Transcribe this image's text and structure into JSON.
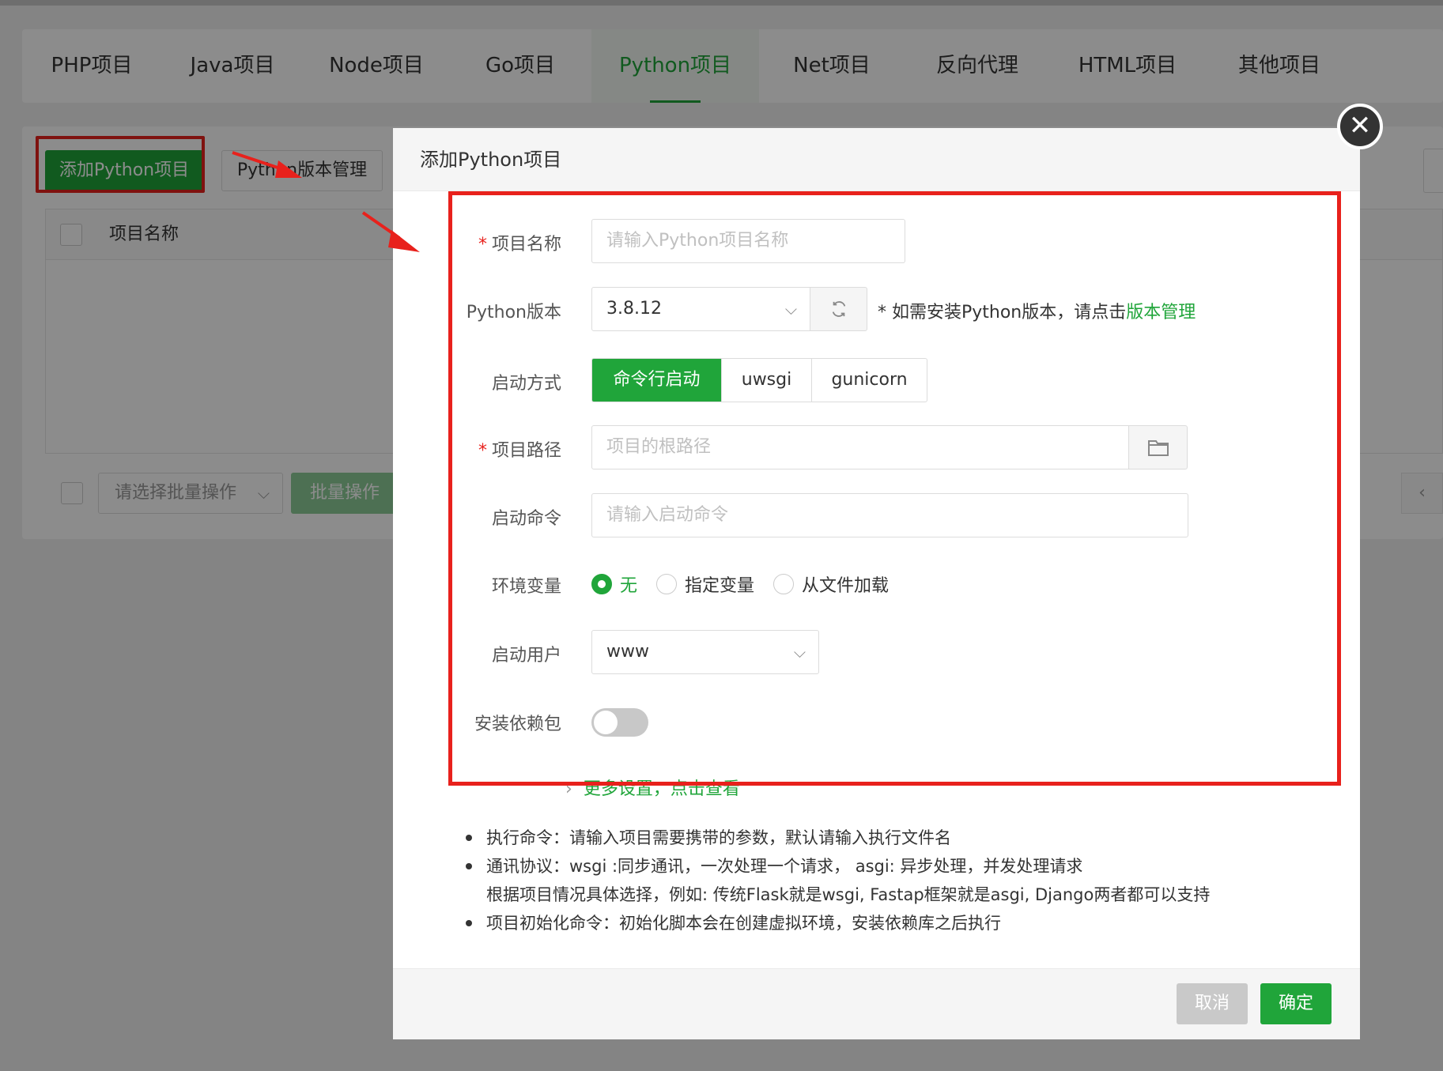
{
  "tabs": [
    "PHP项目",
    "Java项目",
    "Node项目",
    "Go项目",
    "Python项目",
    "Net项目",
    "反向代理",
    "HTML项目",
    "其他项目"
  ],
  "active_tab": "Python项目",
  "toolbar": {
    "add_label": "添加Python项目",
    "version_label": "Python版本管理"
  },
  "table": {
    "col_name": "项目名称"
  },
  "batch": {
    "select_placeholder": "请选择批量操作",
    "button_label": "批量操作"
  },
  "dialog": {
    "title": "添加Python项目",
    "name": {
      "label": "项目名称",
      "placeholder": "请输入Python项目名称"
    },
    "version": {
      "label": "Python版本",
      "value": "3.8.12",
      "hint_prefix": "* 如需安装Python版本，请点击",
      "hint_link": "版本管理"
    },
    "start_mode": {
      "label": "启动方式",
      "options": [
        "命令行启动",
        "uwsgi",
        "gunicorn"
      ],
      "selected": "命令行启动"
    },
    "path": {
      "label": "项目路径",
      "placeholder": "项目的根路径"
    },
    "command": {
      "label": "启动命令",
      "placeholder": "请输入启动命令"
    },
    "env": {
      "label": "环境变量",
      "options": [
        "无",
        "指定变量",
        "从文件加载"
      ],
      "selected": "无"
    },
    "user": {
      "label": "启动用户",
      "value": "www"
    },
    "install_deps": {
      "label": "安装依赖包",
      "enabled": false
    },
    "more_settings": "更多设置，点击查看",
    "notes": [
      "执行命令：请输入项目需要携带的参数，默认请输入执行文件名",
      "通讯协议：wsgi :同步通讯，一次处理一个请求， asgi: 异步处理，并发处理请求",
      "根据项目情况具体选择，例如: 传统Flask就是wsgi, Fastap框架就是asgi, Django两者都可以支持",
      "项目初始化命令：初始化脚本会在创建虚拟环境，安装依赖库之后执行"
    ],
    "cancel_label": "取消",
    "confirm_label": "确定"
  },
  "colors": {
    "brand": "#20a53a",
    "highlight": "#e8211c"
  }
}
